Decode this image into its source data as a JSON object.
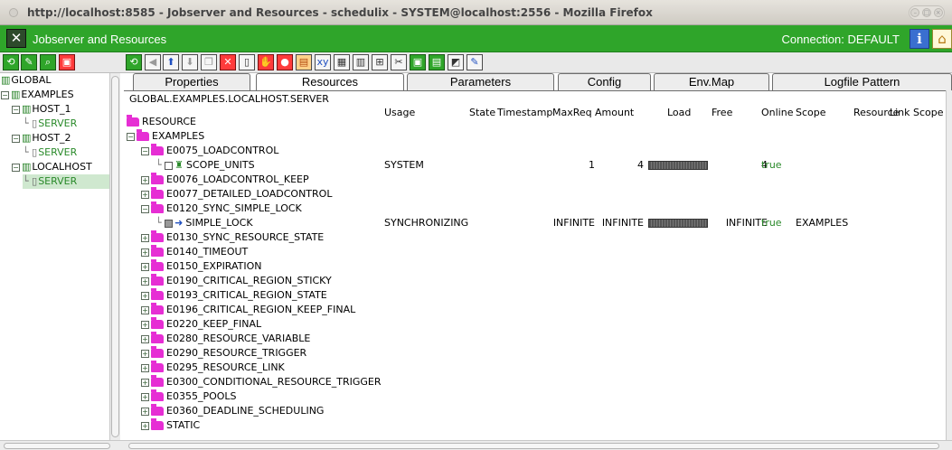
{
  "browser": {
    "title": "http://localhost:8585 - Jobserver and Resources - schedulix - SYSTEM@localhost:2556 - Mozilla Firefox"
  },
  "app": {
    "title": "Jobserver and Resources",
    "connection": "Connection: DEFAULT",
    "info_label": "i",
    "accent": "#2fa52a"
  },
  "left_tree": [
    {
      "label": "GLOBAL",
      "level": 0,
      "icon": "server-group-icon",
      "expander": ""
    },
    {
      "label": "EXAMPLES",
      "level": 0,
      "icon": "server-group-icon",
      "expander": "−"
    },
    {
      "label": "HOST_1",
      "level": 1,
      "icon": "server-group-icon",
      "expander": "−"
    },
    {
      "label": "SERVER",
      "level": 2,
      "icon": "server-icon",
      "expander": "",
      "green": true
    },
    {
      "label": "HOST_2",
      "level": 1,
      "icon": "server-group-icon",
      "expander": "−"
    },
    {
      "label": "SERVER",
      "level": 2,
      "icon": "server-icon",
      "expander": "",
      "green": true
    },
    {
      "label": "LOCALHOST",
      "level": 1,
      "icon": "server-group-icon",
      "expander": "−"
    },
    {
      "label": "SERVER",
      "level": 2,
      "icon": "server-icon",
      "expander": "",
      "green": true,
      "selected": true
    }
  ],
  "tabs": [
    {
      "label": "Properties"
    },
    {
      "label": "Resources",
      "active": true
    },
    {
      "label": "Parameters"
    },
    {
      "label": "Config"
    },
    {
      "label": "Env.Map"
    },
    {
      "label": "Logfile Pattern"
    }
  ],
  "path": "GLOBAL.EXAMPLES.LOCALHOST.SERVER",
  "columns": [
    "Usage",
    "State",
    "Timestamp",
    "MaxReq",
    "Amount",
    "Load",
    "Free",
    "Online",
    "Scope",
    "Resource",
    "Link Scope"
  ],
  "rows": [
    {
      "name": "RESOURCE",
      "level": 0,
      "type": "folder",
      "expander": ""
    },
    {
      "name": "EXAMPLES",
      "level": 0,
      "type": "folder",
      "expander": "−"
    },
    {
      "name": "E0075_LOADCONTROL",
      "level": 1,
      "type": "folder",
      "expander": "−"
    },
    {
      "name": "SCOPE_UNITS",
      "level": 2,
      "type": "resource-scope",
      "usage": "SYSTEM",
      "maxreq": "1",
      "amount": "4",
      "load_fraction": 1.0,
      "free": "4",
      "online": "true"
    },
    {
      "name": "E0076_LOADCONTROL_KEEP",
      "level": 1,
      "type": "folder",
      "expander": "+"
    },
    {
      "name": "E0077_DETAILED_LOADCONTROL",
      "level": 1,
      "type": "folder",
      "expander": "+"
    },
    {
      "name": "E0120_SYNC_SIMPLE_LOCK",
      "level": 1,
      "type": "folder",
      "expander": "−"
    },
    {
      "name": "SIMPLE_LOCK",
      "level": 2,
      "type": "resource-lock",
      "usage": "SYNCHRONIZING",
      "maxreq": "INFINITE",
      "amount": "INFINITE",
      "load_fraction": 1.0,
      "free": "INFINITE",
      "online": "true",
      "scope": "EXAMPLES"
    },
    {
      "name": "E0130_SYNC_RESOURCE_STATE",
      "level": 1,
      "type": "folder",
      "expander": "+"
    },
    {
      "name": "E0140_TIMEOUT",
      "level": 1,
      "type": "folder",
      "expander": "+"
    },
    {
      "name": "E0150_EXPIRATION",
      "level": 1,
      "type": "folder",
      "expander": "+"
    },
    {
      "name": "E0190_CRITICAL_REGION_STICKY",
      "level": 1,
      "type": "folder",
      "expander": "+"
    },
    {
      "name": "E0193_CRITICAL_REGION_STATE",
      "level": 1,
      "type": "folder",
      "expander": "+"
    },
    {
      "name": "E0196_CRITICAL_REGION_KEEP_FINAL",
      "level": 1,
      "type": "folder",
      "expander": "+"
    },
    {
      "name": "E0220_KEEP_FINAL",
      "level": 1,
      "type": "folder",
      "expander": "+"
    },
    {
      "name": "E0280_RESOURCE_VARIABLE",
      "level": 1,
      "type": "folder",
      "expander": "+"
    },
    {
      "name": "E0290_RESOURCE_TRIGGER",
      "level": 1,
      "type": "folder",
      "expander": "+"
    },
    {
      "name": "E0295_RESOURCE_LINK",
      "level": 1,
      "type": "folder",
      "expander": "+"
    },
    {
      "name": "E0300_CONDITIONAL_RESOURCE_TRIGGER",
      "level": 1,
      "type": "folder",
      "expander": "+"
    },
    {
      "name": "E0355_POOLS",
      "level": 1,
      "type": "folder",
      "expander": "+"
    },
    {
      "name": "E0360_DEADLINE_SCHEDULING",
      "level": 1,
      "type": "folder",
      "expander": "+"
    },
    {
      "name": "STATIC",
      "level": 1,
      "type": "folder",
      "expander": "+"
    }
  ]
}
